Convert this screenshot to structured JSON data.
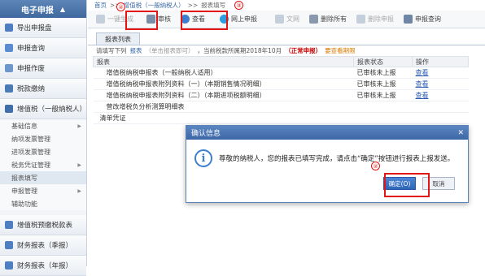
{
  "sidebar": {
    "title": "电子申报",
    "items": [
      {
        "label": "导出申报盘",
        "color": "#4f7fc0"
      },
      {
        "label": "申报查询",
        "color": "#4f7fc0"
      },
      {
        "label": "申报作废",
        "color": "#4f7fc0"
      },
      {
        "label": "税款缴纳",
        "color": "#4f7fc0"
      },
      {
        "label": "增值税（一般纳税人）",
        "color": "#4f7fc0"
      }
    ],
    "subitems": [
      "基础信息",
      "纳项发票管理",
      "进项发票管理",
      "税务凭证管理",
      "报表填写",
      "申报管理",
      "辅助功能"
    ],
    "bottom_items": [
      "增值税预缴税款表",
      "财务报表（季报）",
      "财务报表（年报）"
    ]
  },
  "breadcrumb": {
    "home": "首页",
    "level1": "增值税（一般纳税人）",
    "sep": ">>",
    "current": "报表填写"
  },
  "toolbar": {
    "buttons": [
      "一键生成",
      "审核",
      "查看",
      "网上申报",
      "文网",
      "删除所有",
      "删除申报",
      "申报查询"
    ]
  },
  "tab": "报表列表",
  "hint": {
    "prefix": "请填写下列",
    "link": "报表",
    "note": "（单击报表即可）",
    "period_prefix": "，当前税款所属期2018年10月",
    "status": "（正常申报）",
    "extra": "要查看期限"
  },
  "table": {
    "headers": [
      "报表",
      "报表状态",
      "操作"
    ],
    "rows": [
      {
        "name": "增值税纳税申报表（一般纳税人适用）",
        "status": "已审核未上报",
        "action": "查看"
      },
      {
        "name": "增值税纳税申报表附列资料（一）（本期销售情况明细）",
        "status": "已审核未上报",
        "action": "查看"
      },
      {
        "name": "增值税纳税申报表附列资料（二）（本期进项税额明细）",
        "status": "已审核未上报",
        "action": "查看"
      },
      {
        "name": "营改增税负分析测算明细表",
        "status": "",
        "action": ""
      },
      {
        "name": "清单凭证",
        "status": "",
        "action": ""
      }
    ]
  },
  "dialog": {
    "title": "确认信息",
    "message": "尊敬的纳税人，您的报表已填写完成，请点击“确定”按钮进行报表上报发送。",
    "ok": "确定(O)",
    "cancel": "取消"
  },
  "badges": [
    "②",
    "③",
    "②"
  ]
}
